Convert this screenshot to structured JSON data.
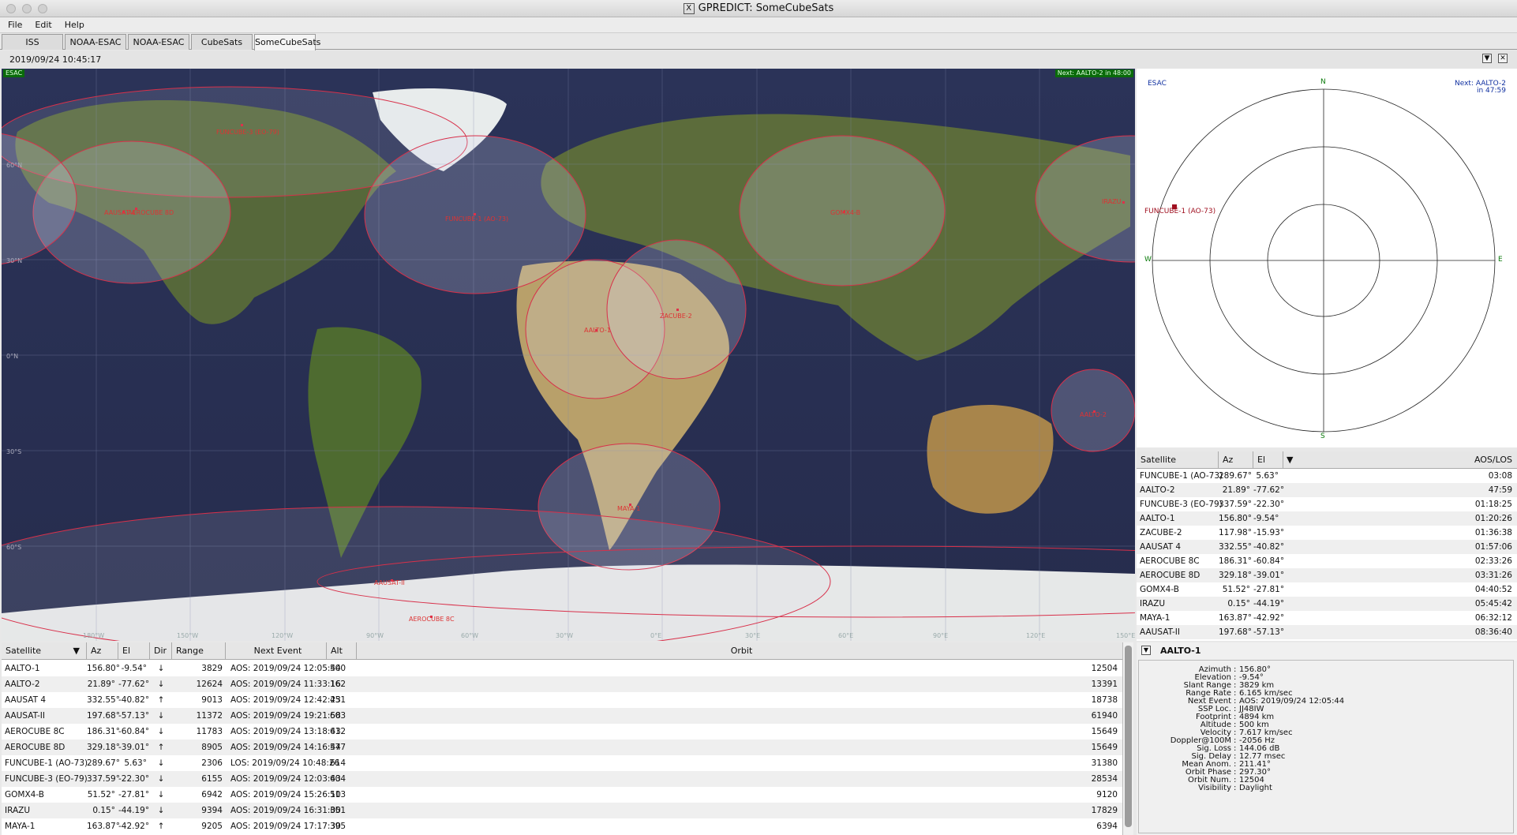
{
  "window": {
    "title": "GPREDICT: SomeCubeSats",
    "x_glyph": "X"
  },
  "menu": [
    "File",
    "Edit",
    "Help"
  ],
  "tabs": [
    "ISS",
    "NOAA-ESAC",
    "NOAA-ESAC",
    "CubeSats",
    "SomeCubeSats"
  ],
  "active_tab": 4,
  "datetime": "2019/09/24 10:45:17",
  "controls": {
    "dropdown": "▼",
    "close": "✕"
  },
  "map": {
    "qth_label": "ESAC",
    "next_label": "Next: AALTO-2 in 48:00",
    "satellites": [
      "FUNCUBE-3 (EO-79)",
      "AAUSAT 4",
      "AEROCUBE 8D",
      "FUNCUBE-1 (AO-73)",
      "GOMX4-B",
      "IRAZU",
      "AALTO-1",
      "ZACUBE-2",
      "AALTO-2",
      "MAYA-1",
      "AAUSAT-II",
      "AEROCUBE 8C"
    ],
    "lat_labels": [
      "60°N",
      "30°N",
      "0°N",
      "30°S",
      "60°S"
    ],
    "lon_labels": [
      "180°W",
      "150°W",
      "120°W",
      "90°W",
      "60°W",
      "30°W",
      "0°E",
      "30°E",
      "60°E",
      "90°E",
      "120°E",
      "150°E"
    ]
  },
  "polar": {
    "qth": "ESAC",
    "next_line1": "Next: AALTO-2",
    "next_line2": "in 47:59",
    "n": "N",
    "s": "S",
    "e": "E",
    "w": "W",
    "sat_label": "FUNCUBE-1 (AO-73)"
  },
  "sat_table": {
    "headers": [
      "Satellite",
      "Az",
      "El",
      "AOS/LOS"
    ],
    "sort_arrow": "▼",
    "rows": [
      [
        "FUNCUBE-1 (AO-73)",
        "289.67°",
        "5.63°",
        "03:08"
      ],
      [
        "AALTO-2",
        "21.89°",
        "-77.62°",
        "47:59"
      ],
      [
        "FUNCUBE-3 (EO-79)",
        "337.59°",
        "-22.30°",
        "01:18:25"
      ],
      [
        "AALTO-1",
        "156.80°",
        "-9.54°",
        "01:20:26"
      ],
      [
        "ZACUBE-2",
        "117.98°",
        "-15.93°",
        "01:36:38"
      ],
      [
        "AAUSAT 4",
        "332.55°",
        "-40.82°",
        "01:57:06"
      ],
      [
        "AEROCUBE 8C",
        "186.31°",
        "-60.84°",
        "02:33:26"
      ],
      [
        "AEROCUBE 8D",
        "329.18°",
        "-39.01°",
        "03:31:26"
      ],
      [
        "GOMX4-B",
        "51.52°",
        "-27.81°",
        "04:40:52"
      ],
      [
        "IRAZU",
        "0.15°",
        "-44.19°",
        "05:45:42"
      ],
      [
        "MAYA-1",
        "163.87°",
        "-42.92°",
        "06:32:12"
      ],
      [
        "AAUSAT-II",
        "197.68°",
        "-57.13°",
        "08:36:40"
      ]
    ]
  },
  "list_table": {
    "headers": [
      "Satellite",
      "Az",
      "El",
      "Dir",
      "Range",
      "Next Event",
      "Alt",
      "Orbit"
    ],
    "sort_arrow": "▼",
    "rows": [
      [
        "AALTO-1",
        "156.80°",
        "-9.54°",
        "↓",
        "3829",
        "AOS: 2019/09/24 12:05:44",
        "500",
        "12504"
      ],
      [
        "AALTO-2",
        "21.89°",
        "-77.62°",
        "↓",
        "12624",
        "AOS: 2019/09/24 11:33:16",
        "162",
        "13391"
      ],
      [
        "AAUSAT 4",
        "332.55°",
        "-40.82°",
        "↑",
        "9013",
        "AOS: 2019/09/24 12:42:23",
        "451",
        "18738"
      ],
      [
        "AAUSAT-II",
        "197.68°",
        "-57.13°",
        "↓",
        "11372",
        "AOS: 2019/09/24 19:21:58",
        "603",
        "61940"
      ],
      [
        "AEROCUBE 8C",
        "186.31°",
        "-60.84°",
        "↓",
        "11783",
        "AOS: 2019/09/24 13:18:43",
        "612",
        "15649"
      ],
      [
        "AEROCUBE 8D",
        "329.18°",
        "-39.01°",
        "↑",
        "8905",
        "AOS: 2019/09/24 14:16:44",
        "577",
        "15649"
      ],
      [
        "FUNCUBE-1 (AO-73)",
        "289.67°",
        "5.63°",
        "↓",
        "2306",
        "LOS: 2019/09/24 10:48:26",
        "614",
        "31380"
      ],
      [
        "FUNCUBE-3 (EO-79)",
        "337.59°",
        "-22.30°",
        "↓",
        "6155",
        "AOS: 2019/09/24 12:03:43",
        "604",
        "28534"
      ],
      [
        "GOMX4-B",
        "51.52°",
        "-27.81°",
        "↓",
        "6942",
        "AOS: 2019/09/24 15:26:10",
        "513",
        "9120"
      ],
      [
        "IRAZU",
        "0.15°",
        "-44.19°",
        "↓",
        "9394",
        "AOS: 2019/09/24 16:31:00",
        "351",
        "17829"
      ],
      [
        "MAYA-1",
        "163.87°",
        "-42.92°",
        "↑",
        "9205",
        "AOS: 2019/09/24 17:17:30",
        "395",
        "6394"
      ]
    ]
  },
  "detail": {
    "name": "AALTO-1",
    "toggle": "▼",
    "fields": [
      [
        "Azimuth",
        "156.80°"
      ],
      [
        "Elevation",
        "-9.54°"
      ],
      [
        "Slant Range",
        "3829 km"
      ],
      [
        "Range Rate",
        "6.165 km/sec"
      ],
      [
        "Next Event",
        "AOS: 2019/09/24 12:05:44"
      ],
      [
        "SSP Loc.",
        "JJ48IW"
      ],
      [
        "Footprint",
        "4894 km"
      ],
      [
        "Altitude",
        "500 km"
      ],
      [
        "Velocity",
        "7.617 km/sec"
      ],
      [
        "Doppler@100M",
        "-2056 Hz"
      ],
      [
        "Sig. Loss",
        "144.06 dB"
      ],
      [
        "Sig. Delay",
        "12.77 msec"
      ],
      [
        "Mean Anom.",
        "211.41°"
      ],
      [
        "Orbit Phase",
        "297.30°"
      ],
      [
        "Orbit Num.",
        "12504"
      ],
      [
        "Visibility",
        "Daylight"
      ]
    ]
  }
}
